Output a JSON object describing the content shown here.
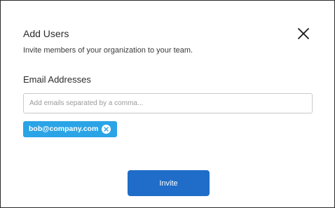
{
  "dialog": {
    "title": "Add Users",
    "subtitle": "Invite members of your organization to your team.",
    "close_icon": "close-icon"
  },
  "email_field": {
    "label": "Email Addresses",
    "value": "",
    "placeholder": "Add emails separated by a comma..."
  },
  "chips": [
    {
      "label": "bob@company.com",
      "remove_icon": "close-circle-icon"
    }
  ],
  "actions": {
    "invite_label": "Invite"
  },
  "colors": {
    "chip_background": "#2aa4e6",
    "button_background": "#1f6dc8",
    "border": "#2a2a2a"
  }
}
